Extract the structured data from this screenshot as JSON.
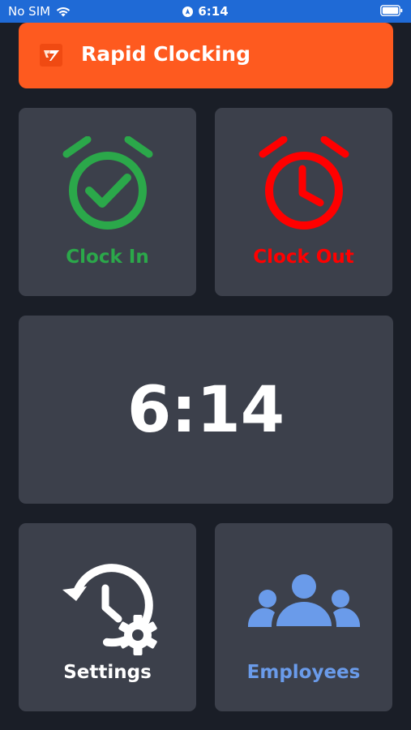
{
  "status_bar": {
    "carrier": "No SIM",
    "time": "6:14",
    "icons": [
      "wifi-icon",
      "location-icon",
      "battery-icon"
    ]
  },
  "header": {
    "title": "Rapid Clocking",
    "logo_icon": "rapid-clocking-logo",
    "color": "#FE5A1F"
  },
  "tiles": {
    "clock_in": {
      "label": "Clock In",
      "icon": "alarm-check-icon",
      "color": "#2BA84A"
    },
    "clock_out": {
      "label": "Clock Out",
      "icon": "alarm-clock-icon",
      "color": "#FF0000"
    },
    "time_display": {
      "value": "6:14"
    },
    "settings": {
      "label": "Settings",
      "icon": "history-gear-icon",
      "color": "#FFFFFF"
    },
    "employees": {
      "label": "Employees",
      "icon": "group-icon",
      "color": "#6A9BEA"
    }
  },
  "colors": {
    "background": "#1A1E27",
    "tile": "#3C404B",
    "status_bar": "#1F6AD6"
  }
}
